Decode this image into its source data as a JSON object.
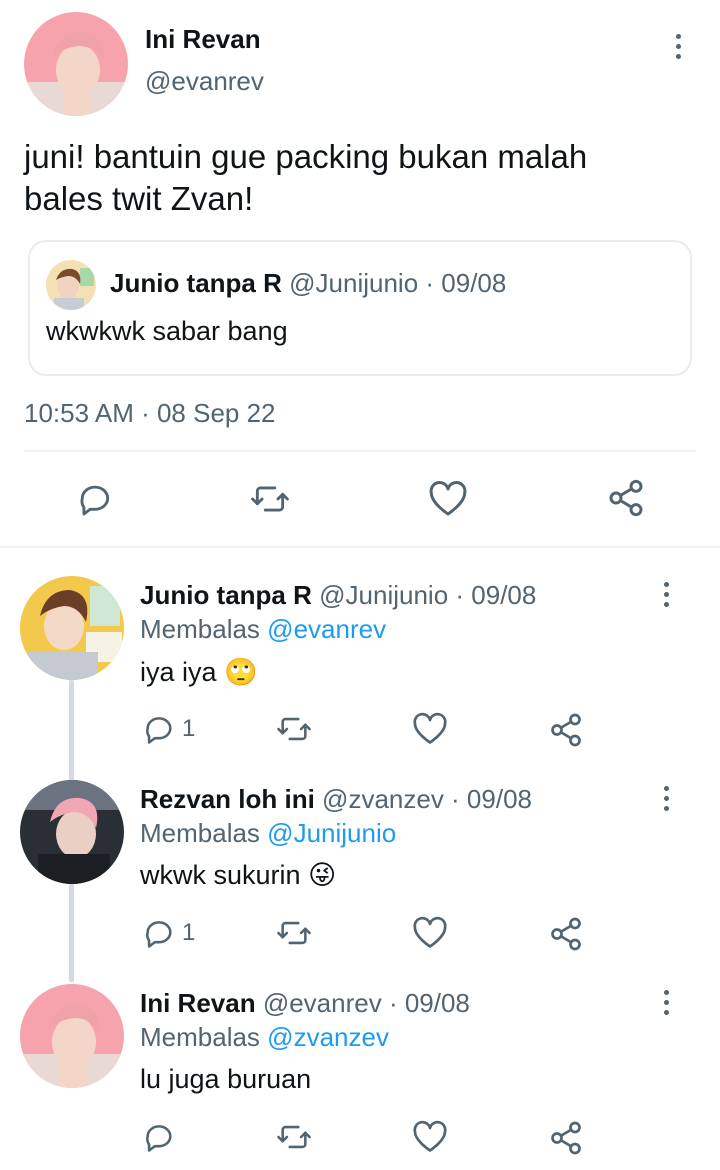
{
  "main_tweet": {
    "name": "Ini Revan",
    "handle": "@evanrev",
    "text_line1": "juni! bantuin gue packing bukan malah",
    "text_line2": "bales twit Zvan!",
    "timestamp": "10:53 AM · 08 Sep 22",
    "quote": {
      "name": "Junio tanpa R",
      "handle_date": "@Junijunio · 09/08",
      "text": "wkwkwk sabar bang"
    }
  },
  "actions": {
    "reply": "reply-icon",
    "retweet": "retweet-icon",
    "like": "heart-icon",
    "share": "share-icon"
  },
  "replies": [
    {
      "name": "Junio tanpa R",
      "handle_date": "@Junijunio · 09/08",
      "replying_prefix": "Membalas",
      "replying_to": "@evanrev",
      "text": "iya iya",
      "emoji": "🙄",
      "reply_count": "1"
    },
    {
      "name": "Rezvan loh ini",
      "handle_date": "@zvanzev · 09/08",
      "replying_prefix": "Membalas",
      "replying_to": "@Junijunio",
      "text": "wkwk sukurin",
      "emoji": "😜",
      "reply_count": "1"
    },
    {
      "name": "Ini Revan",
      "handle_date": "@evanrev · 09/08",
      "replying_prefix": "Membalas",
      "replying_to": "@zvanzev",
      "text": "lu juga buruan",
      "emoji": "",
      "reply_count": ""
    }
  ],
  "colors": {
    "text": "#0f1419",
    "muted": "#536471",
    "link": "#1d9bf0",
    "divider": "#eff3f4"
  }
}
